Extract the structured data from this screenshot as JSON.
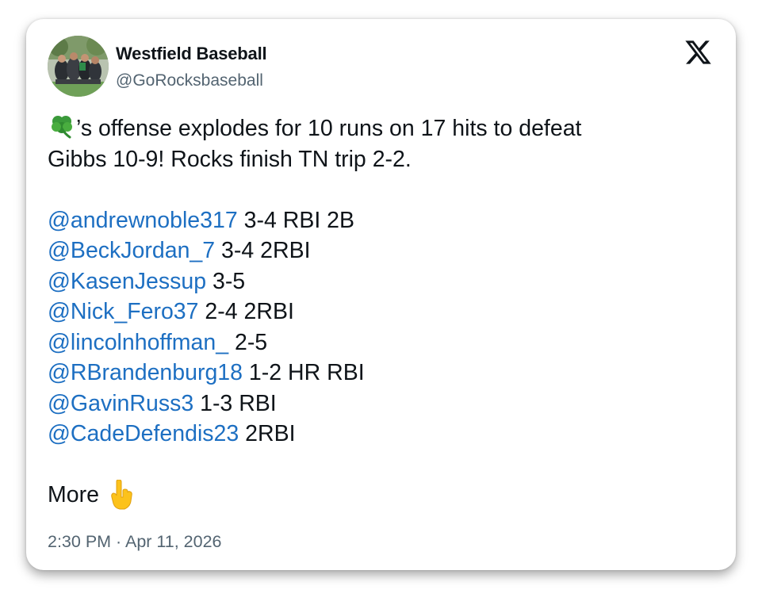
{
  "post": {
    "display_name": "Westfield Baseball",
    "handle": "@GoRocksbaseball",
    "avatar_icon": "team-photo-avatar",
    "platform_icon": "x-logo-icon",
    "intro_line1_rest": "’s offense explodes for 10 runs on 17 hits to defeat",
    "intro_line2": "Gibbs 10-9! Rocks finish TN trip 2-2.",
    "stats": [
      {
        "mention": "@andrewnoble317",
        "text": " 3-4 RBI 2B"
      },
      {
        "mention": "@BeckJordan_7",
        "text": " 3-4 2RBI"
      },
      {
        "mention": "@KasenJessup",
        "text": " 3-5"
      },
      {
        "mention": "@Nick_Fero37",
        "text": " 2-4 2RBI"
      },
      {
        "mention": "@lincolnhoffman_",
        "text": " 2-5"
      },
      {
        "mention": "@RBrandenburg18",
        "text": " 1-2 HR RBI"
      },
      {
        "mention": "@GavinRuss3",
        "text": " 1-3 RBI"
      },
      {
        "mention": "@CadeDefendis23",
        "text": " 2RBI"
      }
    ],
    "more_label": "More",
    "timestamp": "2:30 PM · Apr 11, 2026",
    "colors": {
      "mention": "#1d6fc2",
      "text": "#0f1419",
      "secondary": "#536471"
    }
  }
}
